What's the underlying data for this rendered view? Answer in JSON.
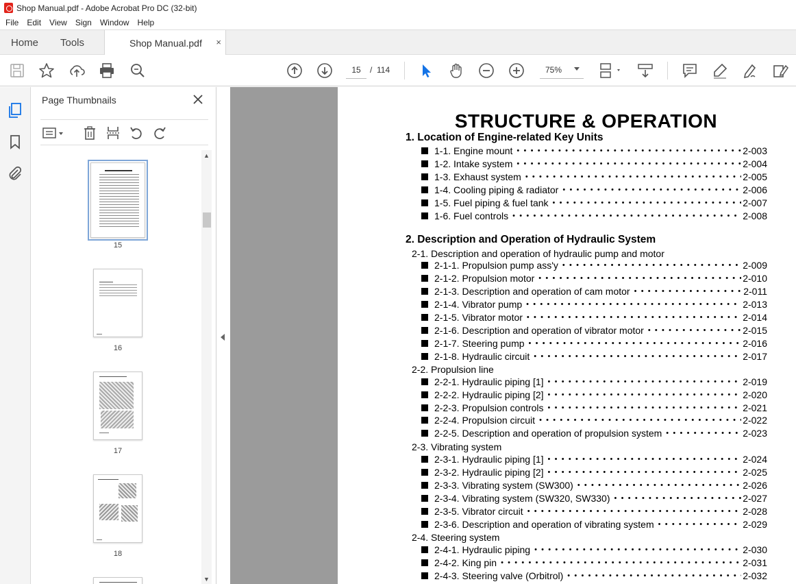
{
  "window": {
    "title": "Shop Manual.pdf - Adobe Acrobat Pro DC (32-bit)"
  },
  "menu": [
    "File",
    "Edit",
    "View",
    "Sign",
    "Window",
    "Help"
  ],
  "tabs": {
    "home": "Home",
    "tools": "Tools",
    "document": "Shop Manual.pdf",
    "close": "×"
  },
  "toolbar": {
    "current_page": "15",
    "page_separator": "/",
    "total_pages": "114",
    "zoom": "75%"
  },
  "thumbnails": {
    "title": "Page Thumbnails",
    "pages": [
      "15",
      "16",
      "17",
      "18"
    ]
  },
  "document": {
    "title": "STRUCTURE & OPERATION",
    "section1": "1. Location of Engine-related Key Units",
    "entries1": [
      {
        "label": "1-1. Engine mount",
        "page": "2-003"
      },
      {
        "label": "1-2. Intake system",
        "page": "2-004"
      },
      {
        "label": "1-3. Exhaust system",
        "page": "2-005"
      },
      {
        "label": "1-4. Cooling piping & radiator",
        "page": "2-006"
      },
      {
        "label": "1-5. Fuel piping & fuel tank",
        "page": "2-007"
      },
      {
        "label": "1-6. Fuel controls",
        "page": "2-008"
      }
    ],
    "section2": "2. Description and Operation of Hydraulic System",
    "sub1": "2-1. Description and operation of hydraulic pump and motor",
    "entries21": [
      {
        "label": "2-1-1. Propulsion pump ass'y",
        "page": "2-009"
      },
      {
        "label": "2-1-2. Propulsion motor",
        "page": "2-010"
      },
      {
        "label": "2-1-3. Description and operation of cam motor",
        "page": "2-011"
      },
      {
        "label": "2-1-4. Vibrator pump",
        "page": "2-013"
      },
      {
        "label": "2-1-5. Vibrator motor",
        "page": "2-014"
      },
      {
        "label": "2-1-6. Description and operation of vibrator motor",
        "page": "2-015"
      },
      {
        "label": "2-1-7. Steering pump",
        "page": "2-016"
      },
      {
        "label": "2-1-8. Hydraulic circuit",
        "page": "2-017"
      }
    ],
    "sub2": "2-2. Propulsion line",
    "entries22": [
      {
        "label": "2-2-1. Hydraulic piping [1]",
        "page": "2-019"
      },
      {
        "label": "2-2-2. Hydraulic piping [2]",
        "page": "2-020"
      },
      {
        "label": "2-2-3. Propulsion controls",
        "page": "2-021"
      },
      {
        "label": "2-2-4. Propulsion circuit",
        "page": "2-022"
      },
      {
        "label": "2-2-5. Description and operation of propulsion system",
        "page": "2-023"
      }
    ],
    "sub3": "2-3. Vibrating system",
    "entries23": [
      {
        "label": "2-3-1. Hydraulic piping [1]",
        "page": "2-024"
      },
      {
        "label": "2-3-2. Hydraulic piping [2]",
        "page": "2-025"
      },
      {
        "label": "2-3-3. Vibrating system (SW300)",
        "page": "2-026"
      },
      {
        "label": "2-3-4. Vibrating system (SW320, SW330)",
        "page": "2-027"
      },
      {
        "label": "2-3-5. Vibrator circuit",
        "page": "2-028"
      },
      {
        "label": "2-3-6. Description and operation of vibrating system",
        "page": "2-029"
      }
    ],
    "sub4": "2-4. Steering system",
    "entries24": [
      {
        "label": "2-4-1. Hydraulic piping",
        "page": "2-030"
      },
      {
        "label": "2-4-2. King pin",
        "page": "2-031"
      },
      {
        "label": "2-4-3. Steering valve (Orbitrol)",
        "page": "2-032"
      }
    ]
  },
  "colors": {
    "accent": "#1473e6",
    "pdf_red": "#e2231a",
    "gutter_gray": "#9b9b9b"
  }
}
